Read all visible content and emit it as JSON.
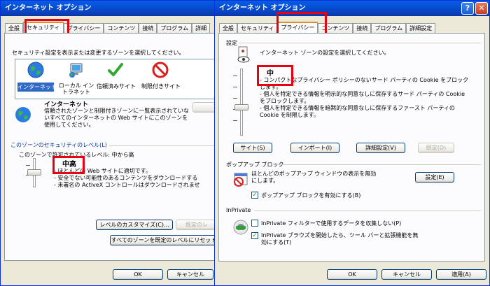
{
  "left_window": {
    "title": "インターネット オプション",
    "tabs": [
      "全般",
      "セキュリティ",
      "プライバシー",
      "コンテンツ",
      "接続",
      "プログラム",
      "詳細"
    ],
    "zone_prompt": "セキュリティ設定を表示または変更するゾーンを選択してください。",
    "zones": [
      {
        "label": "インターネット",
        "icon": "globe-icon"
      },
      {
        "label": "ローカル イントラネット",
        "icon": "intranet-icon"
      },
      {
        "label": "信頼済みサイト",
        "icon": "checkmark-icon"
      },
      {
        "label": "制限付きサイト",
        "icon": "prohibited-icon"
      }
    ],
    "zone_name": "インターネット",
    "zone_description": "信頼されたゾーンと制限付きゾーンに一覧表示されていないすべてのインターネットの Web サイトにこのゾーンを使用してください。",
    "security_level_group": "このゾーンのセキュリティのレベル(L)",
    "allowed_levels": "このゾーンで許可されているレベル: 中から高",
    "level_name": "中高",
    "level_bullets": [
      "- ほとんどの Web サイトに適切です。",
      "- 安全でない可能性のあるコンテンツをダウンロードする",
      "- 未署名の ActiveX コントロールはダウンロードされませ"
    ],
    "custom_level_button": "レベルのカスタマイズ(C)...",
    "default_level_button": "既定のレ",
    "reset_all_button": "すべてのゾーンを既定のレベルにリセット",
    "ok_button": "OK",
    "cancel_button": "キャンセル"
  },
  "right_window": {
    "title": "インターネット オプション",
    "tabs": [
      "全般",
      "セキュリティ",
      "プライバシー",
      "コンテンツ",
      "接続",
      "プログラム",
      "詳細設定"
    ],
    "settings_group": "設定",
    "zone_prompt": "インターネット ゾーンの設定を選択してください。",
    "level_name": "中",
    "level_bullets": [
      "- コンパクトなプライバシー ポリシーのないサード パーティの Cookie をブロックします。",
      "- 個人を特定できる情報を明示的な同意なしに保存するサード パーティの Cookie をブロックします。",
      "- 個人を特定できる情報を暗黙的な同意なしに保存するファースト パーティの Cookie を制限します。"
    ],
    "sites_button": "サイト(S)",
    "import_button": "インポート(I)",
    "advanced_button": "詳細設定(V)",
    "default_button": "既定(D)",
    "popup_group": "ポップアップ ブロック",
    "popup_description": "ほとんどのポップアップ ウィンドウの表示を無効にします。",
    "popup_settings_button": "設定(E)",
    "popup_checkbox_label": "ポップアップ ブロックを有効にする(B)",
    "popup_checked": true,
    "inprivate_group": "InPrivate",
    "inprivate_filter_label": "InPrivate フィルターで使用するデータを収集しない(P)",
    "inprivate_filter_checked": false,
    "inprivate_toolbar_label": "InPrivate ブラウズを開始したら、ツール バーと拡張機能を無効にする(T)",
    "inprivate_toolbar_checked": true,
    "ok_button": "OK",
    "cancel_button": "キャンセル",
    "apply_button": "適用(A)",
    "help_glyph": "?",
    "close_glyph": "✕"
  },
  "colors": {
    "titlebar": "#0a5ce6",
    "highlight": "#e8000e",
    "group_title": "#003399",
    "window_face": "#ece9d8"
  }
}
